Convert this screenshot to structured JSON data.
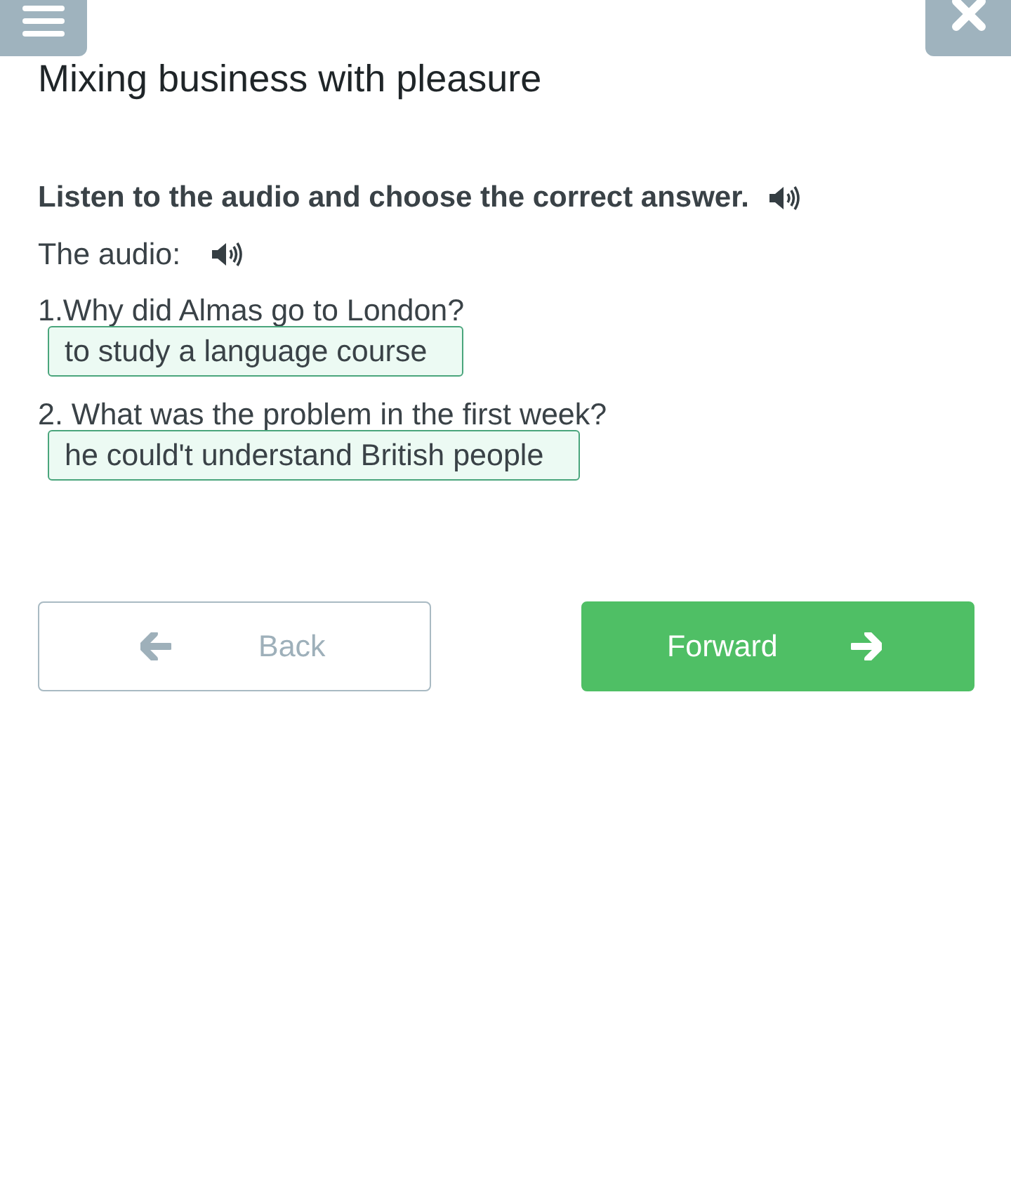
{
  "title": "Mixing business with pleasure",
  "instruction": "Listen to the audio and choose the correct answer.",
  "audio_label": "The audio:",
  "questions": [
    {
      "prompt": "1.Why did Almas go to London?",
      "answer": "to study a language course"
    },
    {
      "prompt": "2. What was the problem in the first week?",
      "answer": "he could't understand British people"
    }
  ],
  "navigation": {
    "back": "Back",
    "forward": "Forward"
  }
}
